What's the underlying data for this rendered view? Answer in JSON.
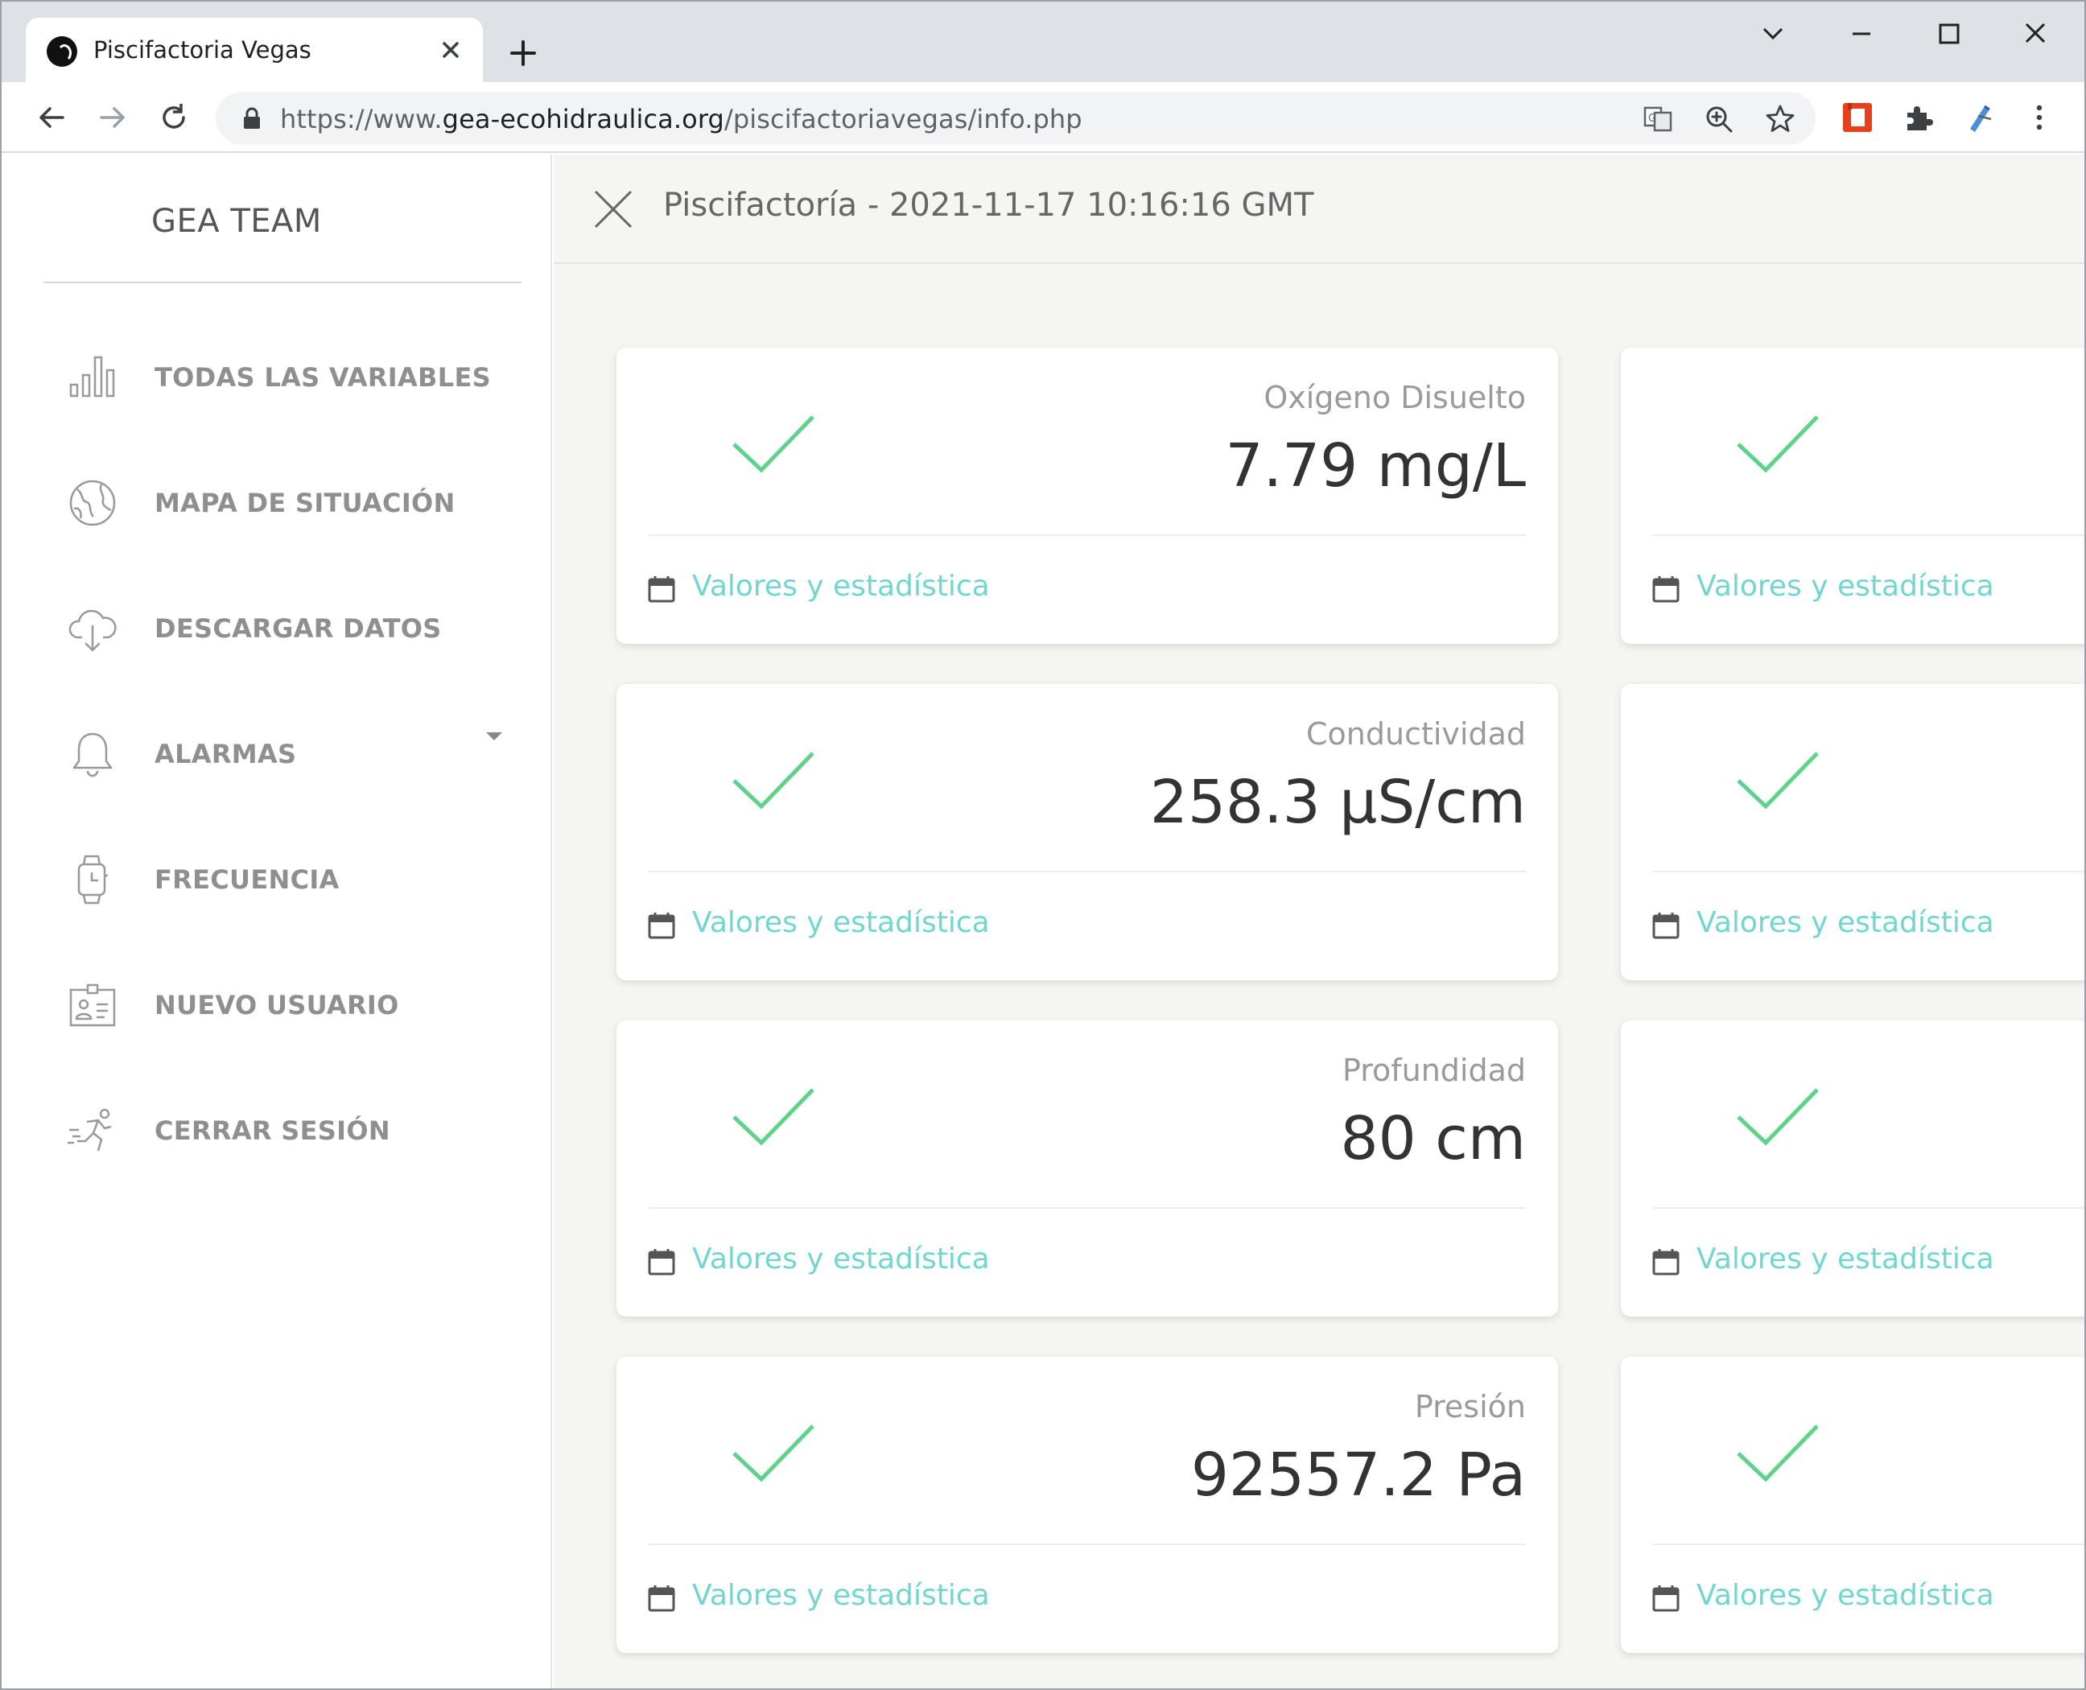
{
  "browser": {
    "tab_title": "Piscifactoria Vegas",
    "url_prefix": "https://www.",
    "url_host": "gea-ecohidraulica.org",
    "url_path": "/piscifactoriavegas/info.php"
  },
  "sidebar": {
    "brand": "GEA TEAM",
    "items": [
      {
        "label": "TODAS LAS VARIABLES",
        "icon": "bar-chart-icon"
      },
      {
        "label": "MAPA DE SITUACIÓN",
        "icon": "globe-icon"
      },
      {
        "label": "DESCARGAR DATOS",
        "icon": "cloud-download-icon"
      },
      {
        "label": "ALARMAS",
        "icon": "bell-icon"
      },
      {
        "label": "FRECUENCIA",
        "icon": "watch-icon"
      },
      {
        "label": "NUEVO USUARIO",
        "icon": "id-card-icon"
      },
      {
        "label": "CERRAR SESIÓN",
        "icon": "running-icon"
      }
    ]
  },
  "header": {
    "title": "Piscifactoría - 2021-11-17 10:16:16 GMT"
  },
  "cards": [
    {
      "label": "Oxígeno Disuelto",
      "value": "7.79 mg/L",
      "link": "Valores y estadística"
    },
    {
      "label": "Conductividad",
      "value": "258.3 μS/cm",
      "link": "Valores y estadística"
    },
    {
      "label": "Profundidad",
      "value": "80 cm",
      "link": "Valores y estadística"
    },
    {
      "label": "Presión",
      "value": "92557.2 Pa",
      "link": "Valores y estadística"
    }
  ],
  "right_cards": [
    {
      "link": "Valores y estadística"
    },
    {
      "link": "Valores y estadística"
    },
    {
      "link": "Valores y estadística"
    },
    {
      "link": "Valores y estadística"
    }
  ],
  "colors": {
    "check": "#5fd28a",
    "link": "#6fd6d0",
    "sidebar_text": "#8f8f8f",
    "background": "#f5f5f2"
  }
}
